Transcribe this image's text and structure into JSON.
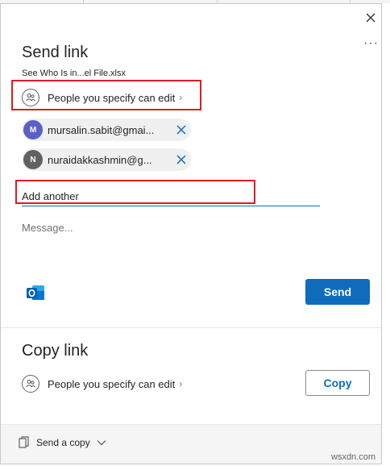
{
  "send_link": {
    "title": "Send link",
    "file_name": "See Who Is in...el File.xlsx",
    "permission": "People you specify can edit",
    "recipients": [
      {
        "initial": "M",
        "email": "mursalin.sabit@gmai...",
        "color": "#5b5fc7"
      },
      {
        "initial": "N",
        "email": "nuraidakkashmin@g...",
        "color": "#616161"
      }
    ],
    "add_placeholder": "Add another",
    "message_placeholder": "Message...",
    "send_label": "Send"
  },
  "copy_link": {
    "title": "Copy link",
    "permission": "People you specify can edit",
    "copy_label": "Copy"
  },
  "footer": {
    "send_copy_label": "Send a copy"
  },
  "header": {
    "more_label": "···"
  },
  "watermark": "wsxdn.com",
  "colors": {
    "accent": "#0f6cbd",
    "highlight": "#e01b24"
  }
}
